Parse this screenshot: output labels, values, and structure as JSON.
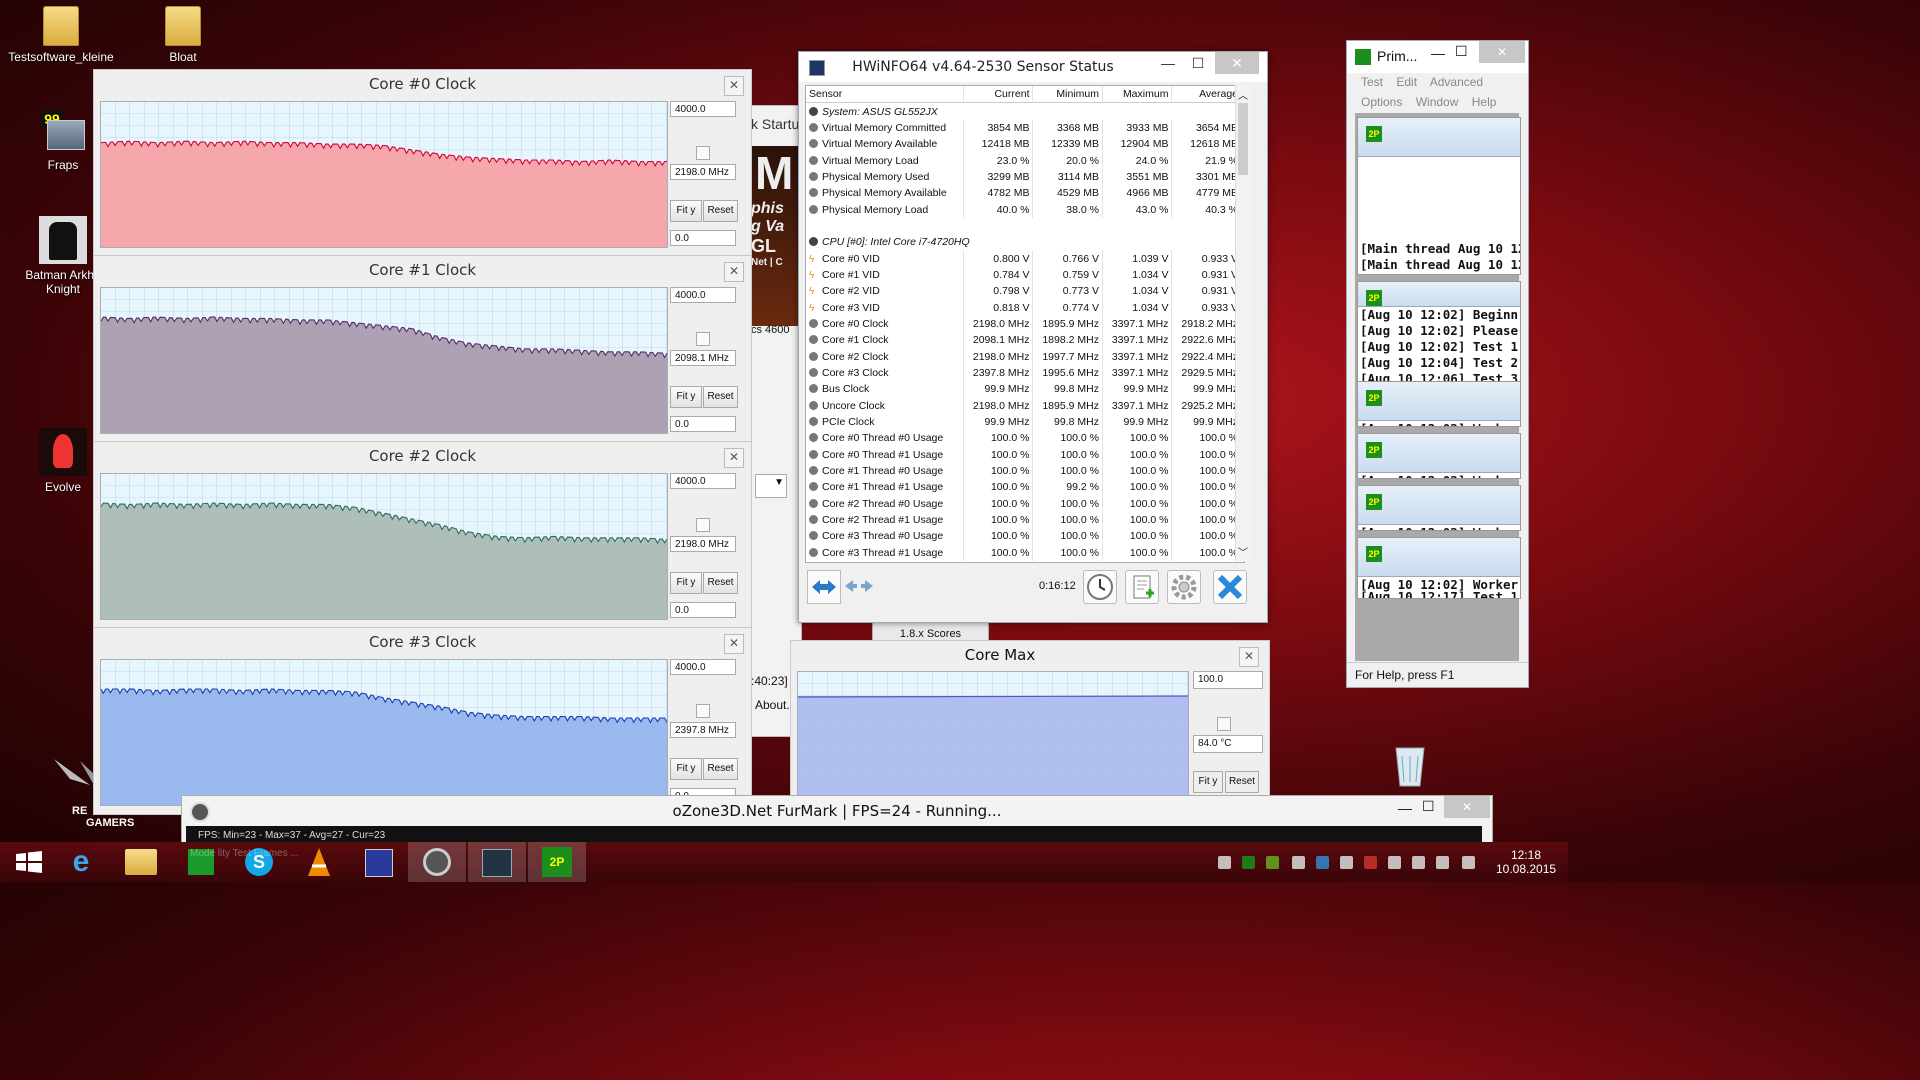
{
  "desktop": {
    "icons": [
      {
        "label": "Testsoftware_kleine"
      },
      {
        "label": "Bloat"
      },
      {
        "label": "Fraps"
      },
      {
        "label": "Batman Arkham Knight",
        "label_line1": "Batman Arkha",
        "label_line2": "Knight"
      },
      {
        "label": "Evolve"
      }
    ]
  },
  "graphs": [
    {
      "title": "Core #0 Clock",
      "max": "4000.0",
      "current": "2198.0 MHz",
      "min": "0.0",
      "fit": "Fit y",
      "reset": "Reset",
      "fill": "#f7a0a4",
      "line": "#d4003b",
      "values": [
        0.72,
        0.73,
        0.72,
        0.73,
        0.72,
        0.73,
        0.72,
        0.72,
        0.71,
        0.71,
        0.7,
        0.67,
        0.64,
        0.62,
        0.61,
        0.6,
        0.6,
        0.59,
        0.6,
        0.59,
        0.59
      ]
    },
    {
      "title": "Core #1 Clock",
      "max": "4000.0",
      "current": "2098.1 MHz",
      "min": "0.0",
      "fit": "Fit y",
      "reset": "Reset",
      "fill": "#a89aad",
      "line": "#5a2a66",
      "values": [
        0.8,
        0.79,
        0.8,
        0.79,
        0.8,
        0.79,
        0.79,
        0.78,
        0.78,
        0.76,
        0.74,
        0.72,
        0.66,
        0.62,
        0.6,
        0.58,
        0.58,
        0.57,
        0.56,
        0.56,
        0.55
      ]
    },
    {
      "title": "Core #2 Clock",
      "max": "4000.0",
      "current": "2198.0 MHz",
      "min": "0.0",
      "fit": "Fit y",
      "reset": "Reset",
      "fill": "#a9bab3",
      "line": "#2e6b5e",
      "values": [
        0.8,
        0.79,
        0.8,
        0.79,
        0.8,
        0.79,
        0.8,
        0.79,
        0.79,
        0.77,
        0.73,
        0.69,
        0.65,
        0.6,
        0.57,
        0.56,
        0.57,
        0.56,
        0.56,
        0.56,
        0.55
      ]
    },
    {
      "title": "Core #3 Clock",
      "max": "4000.0",
      "current": "2397.8 MHz",
      "min": "0.0",
      "fit": "Fit y",
      "reset": "Reset",
      "fill": "#94b4ee",
      "line": "#1c3cb0",
      "values": [
        0.8,
        0.8,
        0.79,
        0.8,
        0.8,
        0.79,
        0.8,
        0.79,
        0.79,
        0.78,
        0.74,
        0.71,
        0.68,
        0.64,
        0.62,
        0.61,
        0.61,
        0.61,
        0.6,
        0.6,
        0.6
      ]
    }
  ],
  "coremax": {
    "title": "Core Max",
    "max": "100.0",
    "current": "84.0 °C",
    "fit": "Fit y",
    "reset": "Reset"
  },
  "hwinfo": {
    "title": "HWiNFO64 v4.64-2530 Sensor Status",
    "columns": [
      "Sensor",
      "Current",
      "Minimum",
      "Maximum",
      "Average"
    ],
    "rows": [
      {
        "type": "group",
        "name": "System: ASUS GL552JX"
      },
      {
        "name": "Virtual Memory Committed",
        "cur": "3854 MB",
        "min": "3368 MB",
        "max": "3933 MB",
        "avg": "3654 MB"
      },
      {
        "name": "Virtual Memory Available",
        "cur": "12418 MB",
        "min": "12339 MB",
        "max": "12904 MB",
        "avg": "12618 MB"
      },
      {
        "name": "Virtual Memory Load",
        "cur": "23.0 %",
        "min": "20.0 %",
        "max": "24.0 %",
        "avg": "21.9 %"
      },
      {
        "name": "Physical Memory Used",
        "cur": "3299 MB",
        "min": "3114 MB",
        "max": "3551 MB",
        "avg": "3301 MB"
      },
      {
        "name": "Physical Memory Available",
        "cur": "4782 MB",
        "min": "4529 MB",
        "max": "4966 MB",
        "avg": "4779 MB"
      },
      {
        "name": "Physical Memory Load",
        "cur": "40.0 %",
        "min": "38.0 %",
        "max": "43.0 %",
        "avg": "40.3 %"
      },
      {
        "type": "blank"
      },
      {
        "type": "group",
        "name": "CPU [#0]: Intel Core i7-4720HQ"
      },
      {
        "name": "Core #0 VID",
        "icon": "bolt",
        "cur": "0.800 V",
        "min": "0.766 V",
        "max": "1.039 V",
        "avg": "0.933 V"
      },
      {
        "name": "Core #1 VID",
        "icon": "bolt",
        "cur": "0.784 V",
        "min": "0.759 V",
        "max": "1.034 V",
        "avg": "0.931 V"
      },
      {
        "name": "Core #2 VID",
        "icon": "bolt",
        "cur": "0.798 V",
        "min": "0.773 V",
        "max": "1.034 V",
        "avg": "0.931 V"
      },
      {
        "name": "Core #3 VID",
        "icon": "bolt",
        "cur": "0.818 V",
        "min": "0.774 V",
        "max": "1.034 V",
        "avg": "0.933 V"
      },
      {
        "name": "Core #0 Clock",
        "cur": "2198.0 MHz",
        "min": "1895.9 MHz",
        "max": "3397.1 MHz",
        "avg": "2918.2 MHz"
      },
      {
        "name": "Core #1 Clock",
        "cur": "2098.1 MHz",
        "min": "1898.2 MHz",
        "max": "3397.1 MHz",
        "avg": "2922.6 MHz"
      },
      {
        "name": "Core #2 Clock",
        "cur": "2198.0 MHz",
        "min": "1997.7 MHz",
        "max": "3397.1 MHz",
        "avg": "2922.4 MHz"
      },
      {
        "name": "Core #3 Clock",
        "cur": "2397.8 MHz",
        "min": "1995.6 MHz",
        "max": "3397.1 MHz",
        "avg": "2929.5 MHz"
      },
      {
        "name": "Bus Clock",
        "cur": "99.9 MHz",
        "min": "99.8 MHz",
        "max": "99.9 MHz",
        "avg": "99.9 MHz"
      },
      {
        "name": "Uncore Clock",
        "cur": "2198.0 MHz",
        "min": "1895.9 MHz",
        "max": "3397.1 MHz",
        "avg": "2925.2 MHz"
      },
      {
        "name": "PCIe Clock",
        "cur": "99.9 MHz",
        "min": "99.8 MHz",
        "max": "99.9 MHz",
        "avg": "99.9 MHz"
      },
      {
        "name": "Core #0 Thread #0 Usage",
        "cur": "100.0 %",
        "min": "100.0 %",
        "max": "100.0 %",
        "avg": "100.0 %"
      },
      {
        "name": "Core #0 Thread #1 Usage",
        "cur": "100.0 %",
        "min": "100.0 %",
        "max": "100.0 %",
        "avg": "100.0 %"
      },
      {
        "name": "Core #1 Thread #0 Usage",
        "cur": "100.0 %",
        "min": "100.0 %",
        "max": "100.0 %",
        "avg": "100.0 %"
      },
      {
        "name": "Core #1 Thread #1 Usage",
        "cur": "100.0 %",
        "min": "99.2 %",
        "max": "100.0 %",
        "avg": "100.0 %"
      },
      {
        "name": "Core #2 Thread #0 Usage",
        "cur": "100.0 %",
        "min": "100.0 %",
        "max": "100.0 %",
        "avg": "100.0 %"
      },
      {
        "name": "Core #2 Thread #1 Usage",
        "cur": "100.0 %",
        "min": "100.0 %",
        "max": "100.0 %",
        "avg": "100.0 %"
      },
      {
        "name": "Core #3 Thread #0 Usage",
        "cur": "100.0 %",
        "min": "100.0 %",
        "max": "100.0 %",
        "avg": "100.0 %"
      },
      {
        "name": "Core #3 Thread #1 Usage",
        "cur": "100.0 %",
        "min": "100.0 %",
        "max": "100.0 %",
        "avg": "100.0 %"
      }
    ],
    "timer": "0:16:12"
  },
  "prime": {
    "title": "Prim...",
    "menu_row1": [
      "Test",
      "Edit",
      "Advanced"
    ],
    "menu_row2": [
      "Options",
      "Window",
      "Help"
    ],
    "main_lines": [
      "[Main thread Aug 10 12",
      "[Main thread Aug 10 12"
    ],
    "worker1_lines": [
      "[Aug 10 12:02] Beginn",
      "[Aug 10 12:02] Please",
      "[Aug 10 12:02] Test 1,",
      "[Aug 10 12:04] Test 2,",
      "[Aug 10 12:06] Test 3,"
    ],
    "worker_line": "[Aug 10 12:02] Worker",
    "last_line": "[Aug 10 12:17] Test 1,",
    "status": "For Help, press F1"
  },
  "background_window": {
    "title_fragment": "k Startu",
    "banner_lines": [
      "M",
      "phis",
      "g Va",
      "GL",
      "Net | C"
    ],
    "gpu": "cs 4600",
    "time": ":40:23]",
    "about": "About..",
    "tab": "1.8.x Scores"
  },
  "furmark": {
    "title": "oZone3D.Net FurMark | FPS=24 - Running...",
    "stats": "FPS: Min=23 - Max=37 - Avg=27 - Cur=23"
  },
  "taskbar": {
    "time": "12:18",
    "date": "10.08.2015"
  },
  "branding": {
    "rog_text": "REPUBLIC OF GAMERS",
    "rog_short": "GAMERS"
  },
  "colors": {
    "accent": "#0078d7"
  }
}
